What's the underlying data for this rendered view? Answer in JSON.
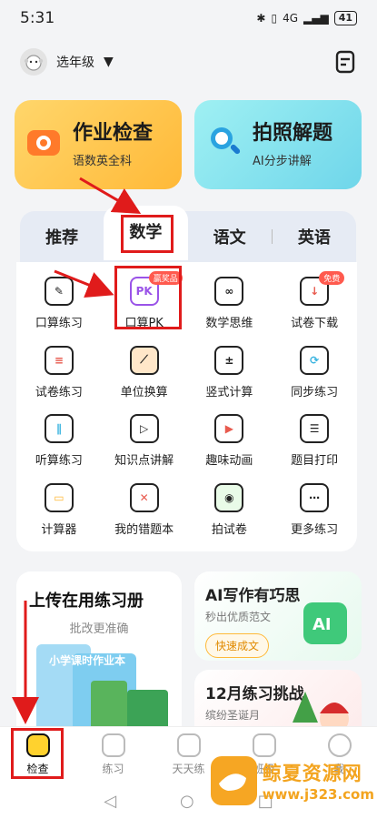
{
  "status": {
    "time": "5:31",
    "battery": "41",
    "network": "4G"
  },
  "header": {
    "grade_label": "选年级"
  },
  "features": [
    {
      "title": "作业检查",
      "subtitle": "语数英全科"
    },
    {
      "title": "拍照解题",
      "subtitle": "AI分步讲解"
    }
  ],
  "tabs": [
    "推荐",
    "数学",
    "语文",
    "英语"
  ],
  "grid": [
    {
      "label": "口算练习",
      "icon": "pencil-board-icon"
    },
    {
      "label": "口算PK",
      "icon": "pk-icon",
      "badge": "赢奖品",
      "glyph": "PK"
    },
    {
      "label": "数学思维",
      "icon": "infinity-bubble-icon"
    },
    {
      "label": "试卷下载",
      "icon": "paper-download-icon",
      "badge": "免费"
    },
    {
      "label": "试卷练习",
      "icon": "paper-100-icon"
    },
    {
      "label": "单位换算",
      "icon": "ruler-icon"
    },
    {
      "label": "竖式计算",
      "icon": "vertical-calc-icon"
    },
    {
      "label": "同步练习",
      "icon": "sync-book-icon"
    },
    {
      "label": "听算练习",
      "icon": "audio-wave-icon"
    },
    {
      "label": "知识点讲解",
      "icon": "screen-play-icon"
    },
    {
      "label": "趣味动画",
      "icon": "video-icon"
    },
    {
      "label": "题目打印",
      "icon": "printer-icon"
    },
    {
      "label": "计算器",
      "icon": "calculator-icon"
    },
    {
      "label": "我的错题本",
      "icon": "mistake-book-icon"
    },
    {
      "label": "拍试卷",
      "icon": "camera-icon"
    },
    {
      "label": "更多练习",
      "icon": "more-book-icon"
    }
  ],
  "upload_card": {
    "title": "上传在用练习册",
    "subtitle": "批改更准确",
    "book_text": "小学课时作业本"
  },
  "ai_card": {
    "title": "AI写作有巧思",
    "subtitle": "秒出优质范文",
    "button": "快速成文"
  },
  "challenge_card": {
    "title": "12月练习挑战",
    "subtitle": "缤纷圣诞月"
  },
  "bottom_nav": [
    "检查",
    "练习",
    "天天练",
    "班级",
    "我"
  ],
  "watermark": {
    "name": "鲸夏资源网",
    "url": "www.j323.com"
  },
  "colors": {
    "yellow": "#ffb938",
    "cyan": "#6fd6ea",
    "red_highlight": "#e01b1b"
  }
}
